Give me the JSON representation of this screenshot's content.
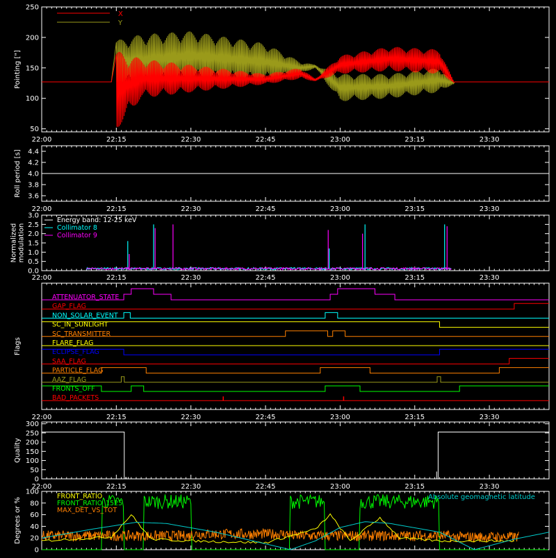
{
  "time_ticks": [
    "22:00",
    "22:15",
    "22:30",
    "22:45",
    "23:00",
    "23:15",
    "23:30"
  ],
  "chart_data": [
    {
      "type": "line",
      "ylabel": "Pointing [\"]",
      "ylim": [
        45,
        250
      ],
      "yticks": [
        "50",
        "100",
        "150",
        "200",
        "250"
      ],
      "yticks_values": [
        50,
        100,
        150,
        200,
        250
      ],
      "x_range_minutes": [
        0,
        102
      ],
      "series": [
        {
          "name": "X",
          "color": "#ff0000",
          "baseline": 127,
          "active_minutes": [
            15,
            83
          ],
          "envelope_minutes": [
            15,
            20,
            30,
            45,
            52,
            55,
            60,
            70,
            80,
            83
          ],
          "env_low": [
            48,
            100,
            110,
            123,
            132,
            128,
            140,
            145,
            140,
            125
          ],
          "env_high": [
            178,
            165,
            155,
            140,
            150,
            132,
            170,
            185,
            180,
            125
          ]
        },
        {
          "name": "Y",
          "color": "#9a9a1a",
          "baseline": 127,
          "active_minutes": [
            15,
            83
          ],
          "envelope_minutes": [
            15,
            20,
            30,
            45,
            52,
            55,
            60,
            70,
            80,
            83
          ],
          "env_low": [
            125,
            120,
            130,
            130,
            140,
            150,
            95,
            100,
            110,
            125
          ],
          "env_high": [
            195,
            205,
            210,
            190,
            160,
            155,
            140,
            140,
            150,
            125
          ]
        }
      ]
    },
    {
      "type": "line",
      "ylabel": "Roll period [s]",
      "ylim": [
        3.5,
        4.5
      ],
      "yticks": [
        "3.6",
        "3.8",
        "4.0",
        "4.2",
        "4.4"
      ],
      "yticks_values": [
        3.6,
        3.8,
        4.0,
        4.2,
        4.4
      ],
      "series": [
        {
          "name": "",
          "color": "#ffffff",
          "values": [
            4.0,
            4.0
          ]
        }
      ]
    },
    {
      "type": "line",
      "ylabel": "Normalized modulation",
      "ylabel_lines": [
        "Normalized",
        "modulation"
      ],
      "ylim": [
        0,
        3.0
      ],
      "yticks": [
        "0.0",
        "0.5",
        "1.0",
        "1.5",
        "2.0",
        "2.5",
        "3.0"
      ],
      "yticks_values": [
        0,
        0.5,
        1.0,
        1.5,
        2.0,
        2.5,
        3.0
      ],
      "legend": [
        "Energy band: 12-25 keV",
        "Collimator 8",
        "Collimator 9"
      ],
      "legend_colors": [
        "#ffffff",
        "#00ffff",
        "#ff00ff"
      ],
      "series": [
        {
          "name": "Collimator 8",
          "color": "#00ffff",
          "spikes_minutes": [
            17.3,
            22.5,
            57.8,
            65,
            81
          ],
          "spikes_values": [
            1.6,
            2.5,
            1.2,
            2.5,
            2.5
          ]
        },
        {
          "name": "Collimator 9",
          "color": "#ff00ff",
          "spikes_minutes": [
            17.6,
            22.8,
            26.4,
            57.6,
            64.5,
            81.5
          ],
          "spikes_values": [
            0.9,
            2.3,
            2.5,
            2.2,
            2.0,
            2.4
          ]
        }
      ]
    },
    {
      "type": "line",
      "ylabel": "Flags",
      "flags": [
        {
          "name": "ATTENUATOR_STATE",
          "color": "#ff00ff",
          "steps": [
            [
              0,
              0
            ],
            [
              16.5,
              1
            ],
            [
              18,
              2
            ],
            [
              22.5,
              1
            ],
            [
              26,
              0
            ],
            [
              58,
              1
            ],
            [
              59.5,
              2
            ],
            [
              67,
              1
            ],
            [
              71,
              0
            ]
          ]
        },
        {
          "name": "GAP_FLAG",
          "color": "#ff0000",
          "steps": [
            [
              0,
              0
            ],
            [
              95,
              1
            ]
          ]
        },
        {
          "name": "NON_SOLAR_EVENT",
          "color": "#00ffff",
          "steps": [
            [
              0,
              0
            ],
            [
              16.5,
              1
            ],
            [
              17.8,
              0
            ],
            [
              57,
              1
            ],
            [
              59.5,
              0
            ]
          ]
        },
        {
          "name": "SC_IN_SUNLIGHT",
          "color": "#ffff00",
          "steps": [
            [
              0,
              1
            ],
            [
              80,
              0
            ]
          ]
        },
        {
          "name": "SC_TRANSMITTER",
          "color": "#ff8000",
          "steps": [
            [
              0,
              0
            ],
            [
              49,
              1
            ],
            [
              57.5,
              0
            ],
            [
              58.5,
              1
            ],
            [
              61,
              0
            ]
          ]
        },
        {
          "name": "FLARE_FLAG",
          "color": "#ffff00",
          "steps": [
            [
              0,
              0
            ]
          ]
        },
        {
          "name": "ECLIPSE_FLAG",
          "color": "#0000ff",
          "steps": [
            [
              0,
              1
            ],
            [
              16.5,
              0
            ],
            [
              80,
              1
            ]
          ]
        },
        {
          "name": "SAA_FLAG",
          "color": "#ff0000",
          "steps": [
            [
              0,
              0
            ],
            [
              94,
              1
            ]
          ]
        },
        {
          "name": "PARTICLE_FLAG",
          "color": "#ff8000",
          "steps": [
            [
              0,
              0
            ],
            [
              12,
              1
            ],
            [
              21,
              0
            ],
            [
              56,
              1
            ],
            [
              66,
              0
            ],
            [
              92,
              1
            ]
          ]
        },
        {
          "name": "AAZ_FLAG",
          "color": "#9a9a1a",
          "steps": [
            [
              0,
              0
            ],
            [
              16,
              1
            ],
            [
              16.6,
              0
            ],
            [
              79.5,
              1
            ],
            [
              80.2,
              0
            ]
          ]
        },
        {
          "name": "FRONTS_OFF",
          "color": "#00ff00",
          "steps": [
            [
              0,
              1
            ],
            [
              12,
              0
            ],
            [
              18,
              1
            ],
            [
              20.5,
              0
            ],
            [
              57,
              1
            ],
            [
              64,
              0
            ],
            [
              84,
              1
            ]
          ]
        },
        {
          "name": "BAD_PACKETS",
          "color": "#ff0000",
          "spikes": [
            36.5,
            60.7
          ]
        }
      ]
    },
    {
      "type": "line",
      "ylabel": "Quality",
      "ylim": [
        0,
        310
      ],
      "yticks": [
        "0",
        "50",
        "100",
        "150",
        "200",
        "250",
        "300"
      ],
      "yticks_values": [
        0,
        50,
        100,
        150,
        200,
        250,
        300
      ],
      "series": [
        {
          "name": "",
          "color": "#ffffff",
          "segments": [
            [
              0,
              255
            ],
            [
              16.6,
              255
            ],
            [
              16.6,
              0
            ],
            [
              79.7,
              0
            ],
            [
              79.7,
              255
            ],
            [
              102,
              255
            ]
          ]
        }
      ]
    },
    {
      "type": "line",
      "ylabel": "Degrees or %",
      "ylim": [
        0,
        100
      ],
      "yticks": [
        "0",
        "20",
        "40",
        "60",
        "80",
        "100"
      ],
      "yticks_values": [
        0,
        20,
        40,
        60,
        80,
        100
      ],
      "legend": [
        "FRONT_RATIO",
        "FRONT_RATIO_1525",
        "MAX_DET_VS_TOT"
      ],
      "legend_colors": [
        "#ffff00",
        "#00ff00",
        "#ff8000"
      ],
      "right_legend": "Absolute geomagnetic latitude",
      "right_legend_color": "#00cccc",
      "series": [
        {
          "name": "Absolute geomagnetic latitude",
          "color": "#00cccc",
          "x_minutes": [
            0,
            10,
            19,
            25,
            35,
            45,
            50,
            55,
            60,
            65,
            70,
            80,
            87,
            95,
            102
          ],
          "values": [
            20,
            35,
            47,
            45,
            30,
            10,
            0,
            15,
            38,
            48,
            45,
            30,
            0,
            18,
            30
          ]
        }
      ]
    }
  ]
}
